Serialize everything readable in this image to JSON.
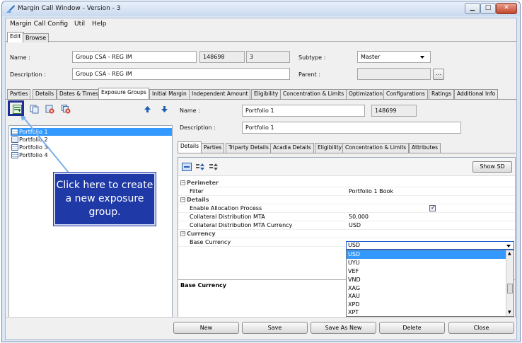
{
  "window": {
    "title": "Margin Call Window - Version - 3"
  },
  "menu": [
    "Margin Call Config",
    "Util",
    "Help"
  ],
  "top_tabs": [
    "Edit",
    "Browse"
  ],
  "form": {
    "name_label": "Name :",
    "name_value": "Group CSA - REG IM",
    "id_value": "148698",
    "version_value": "3",
    "subtype_label": "Subtype :",
    "subtype_value": "Master",
    "description_label": "Description :",
    "description_value": "Group CSA - REG IM",
    "parent_label": "Parent :",
    "parent_value": "",
    "browse_btn": "..."
  },
  "main_tabs": [
    "Parties",
    "Details",
    "Dates & Times",
    "Exposure Groups",
    "Initial Margin",
    "Independent Amount",
    "Eligibility",
    "Concentration & Limits",
    "Optimization",
    "Configurations",
    "Ratings",
    "Additional Info"
  ],
  "tree": [
    {
      "label": "Portfolio 1",
      "selected": true
    },
    {
      "label": "Portfolio 2",
      "selected": false
    },
    {
      "label": "Portfolio 3",
      "selected": false
    },
    {
      "label": "Portfolio 4",
      "selected": false
    }
  ],
  "detail": {
    "name_label": "Name :",
    "name_value": "Portfolio 1",
    "id_value": "148699",
    "description_label": "Description :",
    "description_value": "Portfolio 1"
  },
  "sub_tabs": [
    "Details",
    "Parties",
    "Triparty Details",
    "Acadia Details",
    "Eligibility",
    "Concentration & Limits",
    "Attributes"
  ],
  "show_sd_label": "Show SD",
  "properties": {
    "perimeter": "Perimeter",
    "filter_key": "Filter",
    "filter_value": "Portfolio 1 Book",
    "details": "Details",
    "allocation_key": "Enable Allocation Process",
    "mta_key": "Collateral Distribution MTA",
    "mta_value": "50,000",
    "mta_ccy_key": "Collateral Distribution MTA Currency",
    "mta_ccy_value": "USD",
    "currency": "Currency",
    "base_ccy_key": "Base Currency",
    "base_ccy_value": "USD"
  },
  "dropdown_options": [
    "USD",
    "UYU",
    "VEF",
    "VND",
    "XAG",
    "XAU",
    "XPD",
    "XPT"
  ],
  "description_panel_title": "Base Currency",
  "bottom_buttons": [
    "New",
    "Save",
    "Save As New",
    "Delete",
    "Close"
  ],
  "callout_text": "Click here to create a new exposure group.",
  "colors": {
    "accent": "#3399ff",
    "callout": "#1f3aa6"
  }
}
